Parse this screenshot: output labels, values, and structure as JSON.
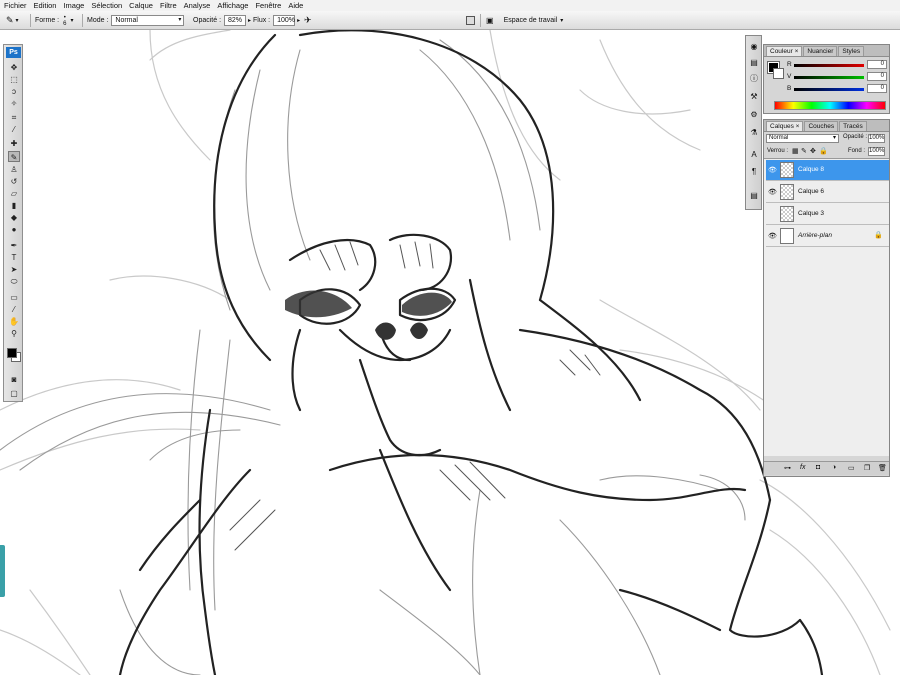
{
  "menu": [
    "Fichier",
    "Edition",
    "Image",
    "Sélection",
    "Calque",
    "Filtre",
    "Analyse",
    "Affichage",
    "Fenêtre",
    "Aide"
  ],
  "options": {
    "forme_label": "Forme :",
    "brush_size": "6",
    "mode_label": "Mode :",
    "mode_value": "Normal",
    "opacity_label": "Opacité :",
    "opacity_value": "82%",
    "flux_label": "Flux :",
    "flux_value": "100%",
    "workspace_label": "Espace de travail"
  },
  "toolbox": {
    "logo": "Ps",
    "tools": [
      "move-icon",
      "marquee-icon",
      "lasso-icon",
      "magic-wand-icon",
      "crop-icon",
      "eyedropper-icon",
      "healing-icon",
      "brush-icon",
      "stamp-icon",
      "history-brush-icon",
      "eraser-icon",
      "gradient-icon",
      "blur-icon",
      "dodge-icon",
      "pen-icon",
      "type-icon",
      "path-select-icon",
      "shape-icon",
      "notes-icon",
      "eyedropper2-icon",
      "hand-icon",
      "zoom-icon"
    ],
    "selected_tool": "brush-icon",
    "foreground_color": "#000000",
    "background_color": "#ffffff"
  },
  "color_panel": {
    "tabs": [
      "Couleur",
      "Nuancier",
      "Styles"
    ],
    "active_tab": "Couleur",
    "channels": [
      {
        "label": "R",
        "value": "0",
        "color": "#d02020"
      },
      {
        "label": "V",
        "value": "0",
        "color": "#20a020"
      },
      {
        "label": "B",
        "value": "0",
        "color": "#2040d0"
      }
    ]
  },
  "layers_panel": {
    "tabs": [
      "Calques",
      "Couches",
      "Tracés"
    ],
    "active_tab": "Calques",
    "blend_mode": "Normal",
    "opacity_label": "Opacité :",
    "opacity_value": "100%",
    "lock_label": "Verrou :",
    "fill_label": "Fond :",
    "fill_value": "100%",
    "layers": [
      {
        "name": "Calque 8",
        "visible": true,
        "active": true
      },
      {
        "name": "Calque 6",
        "visible": true,
        "active": false
      },
      {
        "name": "Calque 3",
        "visible": false,
        "active": false
      },
      {
        "name": "Arrière-plan",
        "visible": true,
        "active": false,
        "locked": true
      }
    ]
  },
  "accent_color": "#3d96ec"
}
